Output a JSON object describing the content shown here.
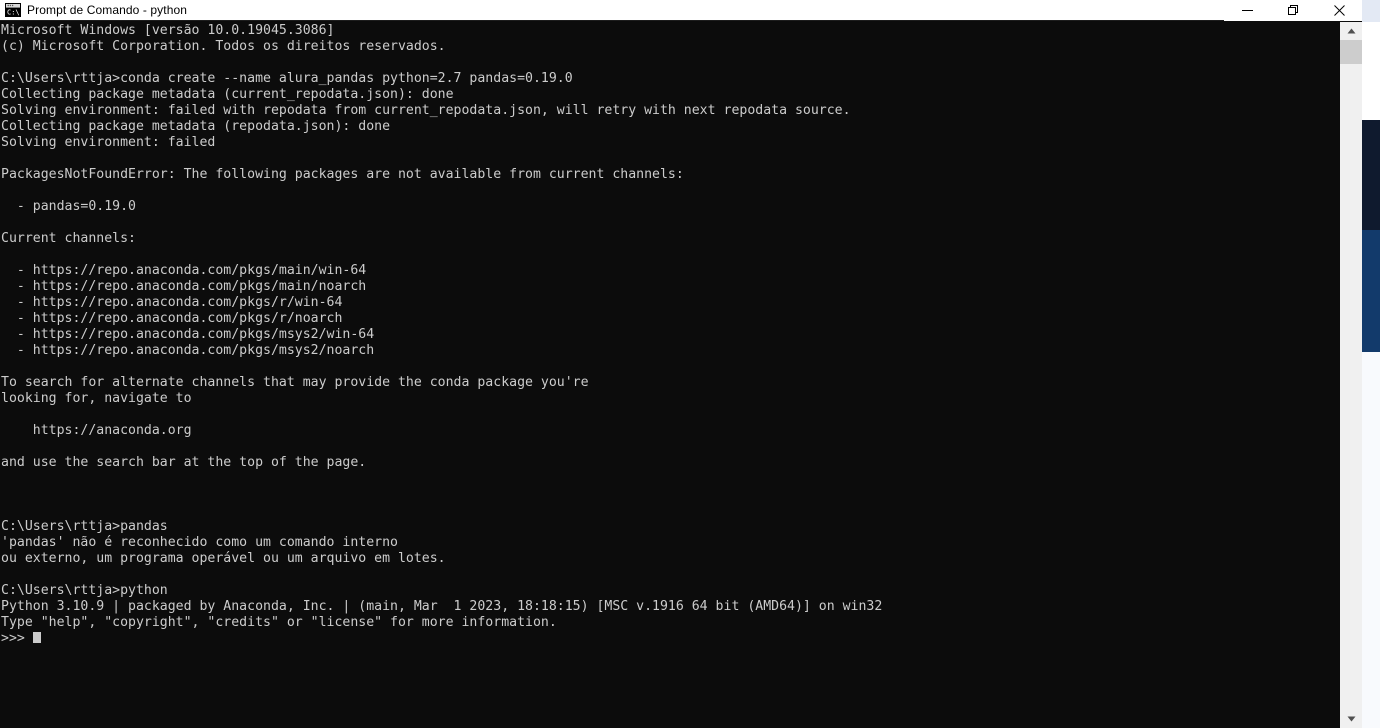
{
  "window": {
    "title": "Prompt de Comando - python",
    "icon": "console-icon",
    "controls": {
      "minimize": "—",
      "restore": "❐",
      "close": "✕",
      "minimize_name": "minimize-button",
      "restore_name": "restore-button",
      "close_name": "close-button"
    },
    "colors": {
      "background": "#0c0c0c",
      "foreground": "#cccccc",
      "titlebar_bg": "#ffffff",
      "scrollbar_track": "#f0f0f0",
      "scrollbar_thumb": "#cdcdcd"
    }
  },
  "scrollbar": {
    "up_arrow": "▲",
    "down_arrow": "▼",
    "thumb_position_percent": 3
  },
  "terminal": {
    "lines": [
      "Microsoft Windows [versão 10.0.19045.3086]",
      "(c) Microsoft Corporation. Todos os direitos reservados.",
      "",
      "C:\\Users\\rttja>conda create --name alura_pandas python=2.7 pandas=0.19.0",
      "Collecting package metadata (current_repodata.json): done",
      "Solving environment: failed with repodata from current_repodata.json, will retry with next repodata source.",
      "Collecting package metadata (repodata.json): done",
      "Solving environment: failed",
      "",
      "PackagesNotFoundError: The following packages are not available from current channels:",
      "",
      "  - pandas=0.19.0",
      "",
      "Current channels:",
      "",
      "  - https://repo.anaconda.com/pkgs/main/win-64",
      "  - https://repo.anaconda.com/pkgs/main/noarch",
      "  - https://repo.anaconda.com/pkgs/r/win-64",
      "  - https://repo.anaconda.com/pkgs/r/noarch",
      "  - https://repo.anaconda.com/pkgs/msys2/win-64",
      "  - https://repo.anaconda.com/pkgs/msys2/noarch",
      "",
      "To search for alternate channels that may provide the conda package you're",
      "looking for, navigate to",
      "",
      "    https://anaconda.org",
      "",
      "and use the search bar at the top of the page.",
      "",
      "",
      "",
      "C:\\Users\\rttja>pandas",
      "'pandas' não é reconhecido como um comando interno",
      "ou externo, um programa operável ou um arquivo em lotes.",
      "",
      "C:\\Users\\rttja>python",
      "Python 3.10.9 | packaged by Anaconda, Inc. | (main, Mar  1 2023, 18:18:15) [MSC v.1916 64 bit (AMD64)] on win32",
      "Type \"help\", \"copyright\", \"credits\" or \"license\" for more information.",
      ">>> "
    ],
    "prompt": ">>>",
    "cursor": "block"
  },
  "background_window": {
    "strips": [
      {
        "name": "light-top",
        "color": "#e3e9f4"
      },
      {
        "name": "white",
        "color": "#ffffff"
      },
      {
        "name": "navy",
        "color": "#0f1a2e"
      },
      {
        "name": "blue",
        "color": "#123a6b"
      },
      {
        "name": "pale",
        "color": "#f8fafd"
      }
    ]
  }
}
